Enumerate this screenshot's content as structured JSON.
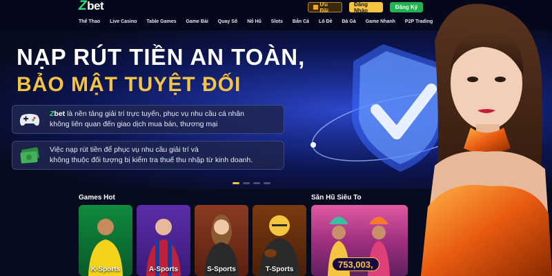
{
  "header": {
    "logo": {
      "z": "Z",
      "rest": "bet"
    },
    "buttons": {
      "promo": "Ưu Đãi",
      "login": "Đăng Nhập",
      "register": "Đăng Ký"
    },
    "nav": [
      "Thể Thao",
      "Live Casino",
      "Table Games",
      "Game Bài",
      "Quay Số",
      "Nổ Hũ",
      "Slots",
      "Bắn Cá",
      "Lô Đề",
      "Đá Gà",
      "Game Nhanh",
      "P2P Trading"
    ]
  },
  "hero": {
    "title_line1": "NẠP RÚT TIỀN AN TOÀN,",
    "title_line2": "BẢO MẬT TUYỆT ĐỐI",
    "card1": {
      "logo_z": "Z",
      "logo_rest": "bet",
      "text": " là nền tảng giải trí trực tuyến, phục vụ nhu cầu cá nhân",
      "text2": "không liên quan đến giao dịch mua bán, thương mại"
    },
    "card2": {
      "text": "Việc nạp rút tiền để phục vụ nhu cầu giải trí và",
      "text2": "không thuộc đối tượng bị kiểm tra thuế thu nhập từ kinh doanh."
    },
    "slides": 4,
    "active_slide": 1
  },
  "games_hot": {
    "title": "Games Hot",
    "items": [
      {
        "label": "K-Sports"
      },
      {
        "label": "A-Sports"
      },
      {
        "label": "S-Sports"
      },
      {
        "label": "T-Sports"
      }
    ]
  },
  "jackpot": {
    "title": "Săn Hũ Siêu To",
    "value": "753,003,"
  },
  "colors": {
    "accent_gold": "#f5c542",
    "brand_green": "#21b34f",
    "bg": "#070b1e"
  }
}
